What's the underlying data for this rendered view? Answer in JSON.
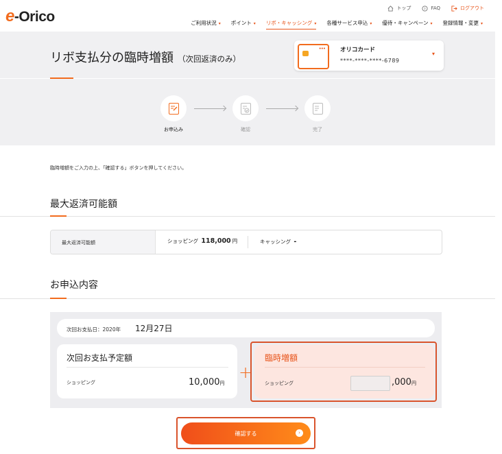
{
  "header": {
    "logo_e": "e",
    "logo_text": "-Orico",
    "top_links": [
      {
        "label": "トップ",
        "icon": "home-icon"
      },
      {
        "label": "FAQ",
        "icon": "question-icon"
      },
      {
        "label": "ログアウト",
        "icon": "logout-icon"
      }
    ],
    "nav": [
      {
        "label": "ご利用状況"
      },
      {
        "label": "ポイント"
      },
      {
        "label": "リボ・キャッシング"
      },
      {
        "label": "各種サービス申込"
      },
      {
        "label": "優待・キャンペーン"
      },
      {
        "label": "登録情報・変更"
      }
    ],
    "active_nav": "リボ・キャッシング",
    "accent_color": "#f26b1d"
  },
  "page": {
    "title": "リボ支払分の臨時増額",
    "title_suffix": "（次回返済のみ）",
    "card": {
      "name": "オリコカード",
      "number": "****-****-****-6789",
      "dots": "•••"
    }
  },
  "steps": [
    {
      "label": "お申込み",
      "icon": "form-edit-icon",
      "active": true
    },
    {
      "label": "確認",
      "icon": "document-check-icon",
      "active": false
    },
    {
      "label": "完了",
      "icon": "document-icon",
      "active": false
    }
  ],
  "instruction": "臨時増額をご入力の上、「確認する」ボタンを押してください。",
  "max_section": {
    "heading": "最大返済可能額",
    "label": "最大返済可能額",
    "shopping_label": "ショッピング",
    "shopping_value": "118,000",
    "yen": "円",
    "cashing_label": "キャッシング",
    "cashing_value": "-"
  },
  "apply_section": {
    "heading": "お申込内容",
    "date_label": "次回お支払日：2020年",
    "date_value": "12月27日",
    "scheduled": {
      "title": "次回お支払予定額",
      "row_label": "ショッピング",
      "amount": "10,000",
      "yen": "円"
    },
    "plus": "+",
    "increase": {
      "title": "臨時増額",
      "row_label": "ショッピング",
      "input_value": "",
      "suffix": ",000",
      "yen": "円"
    }
  },
  "confirm_button": {
    "label": "確認する",
    "icon": "arrow-circle-icon"
  }
}
